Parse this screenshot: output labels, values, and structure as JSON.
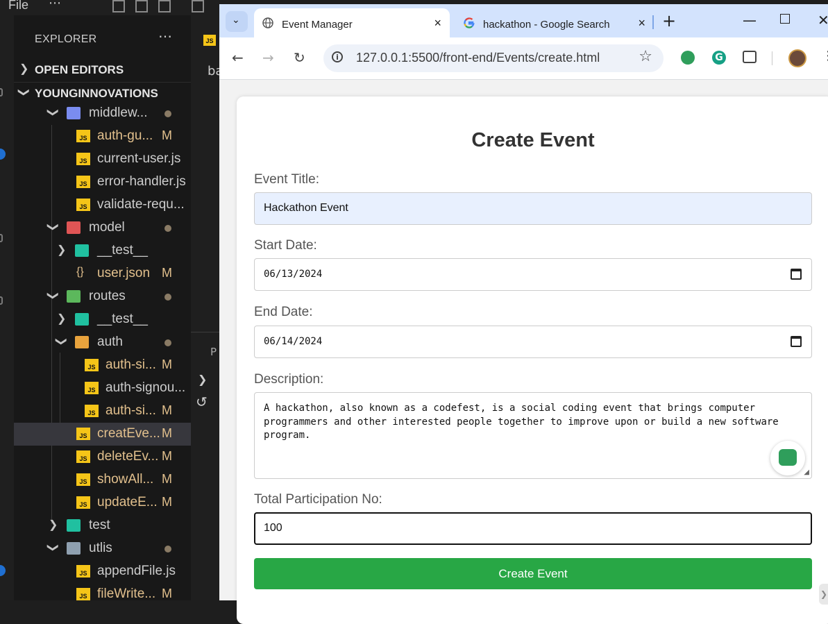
{
  "vscode": {
    "menu_file": "File",
    "menu_more": "⋯",
    "explorer_title": "EXPLORER",
    "explorer_more": "⋯",
    "open_editors": "OPEN EDITORS",
    "workspace": "YOUNGINNOVATIONS",
    "editor_tab_icon": "JS",
    "editor_text": "ba",
    "panel_text": "P",
    "tree": [
      {
        "name": "middlew...",
        "kind": "folder",
        "icon": "middleware-folder-icon",
        "chevron": "open",
        "status": "dot"
      },
      {
        "name": "auth-gu...",
        "kind": "js",
        "status": "M"
      },
      {
        "name": "current-user.js",
        "kind": "js",
        "status": ""
      },
      {
        "name": "error-handler.js",
        "kind": "js",
        "status": ""
      },
      {
        "name": "validate-requ...",
        "kind": "js",
        "status": ""
      },
      {
        "name": "model",
        "kind": "folder",
        "icon": "model-folder-icon",
        "chevron": "open",
        "status": "dot"
      },
      {
        "name": "__test__",
        "kind": "folder",
        "icon": "test-folder-icon",
        "chevron": "closed",
        "status": ""
      },
      {
        "name": "user.json",
        "kind": "json",
        "status": "M"
      },
      {
        "name": "routes",
        "kind": "folder",
        "icon": "routes-folder-icon",
        "chevron": "open",
        "status": "dot"
      },
      {
        "name": "__test__",
        "kind": "folder",
        "icon": "test-folder-icon",
        "chevron": "closed",
        "status": ""
      },
      {
        "name": "auth",
        "kind": "folder",
        "icon": "auth-folder-icon",
        "chevron": "open",
        "status": "dot"
      },
      {
        "name": "auth-si...",
        "kind": "js",
        "status": "M"
      },
      {
        "name": "auth-signou...",
        "kind": "js",
        "status": ""
      },
      {
        "name": "auth-si...",
        "kind": "js",
        "status": "M"
      },
      {
        "name": "creatEve...",
        "kind": "js",
        "status": "M"
      },
      {
        "name": "deleteEv...",
        "kind": "js",
        "status": "M"
      },
      {
        "name": "showAll...",
        "kind": "js",
        "status": "M"
      },
      {
        "name": "updateE...",
        "kind": "js",
        "status": "M"
      },
      {
        "name": "test",
        "kind": "folder",
        "icon": "test-folder-icon",
        "chevron": "closed",
        "status": ""
      },
      {
        "name": "utlis",
        "kind": "folder",
        "icon": "folder-icon",
        "chevron": "open",
        "status": "dot"
      },
      {
        "name": "appendFile.js",
        "kind": "js",
        "status": ""
      },
      {
        "name": "fileWrite...",
        "kind": "js",
        "status": "M"
      }
    ],
    "modified_color": "#e2c08d",
    "js_icon_color": "#f5c518"
  },
  "browser": {
    "tabs": [
      {
        "title": "Event Manager",
        "favicon": "globe-icon"
      },
      {
        "title": "hackathon - Google Search",
        "favicon": "google-icon"
      }
    ],
    "tab_close": "×",
    "new_tab": "+",
    "url": "127.0.0.1:5500/front-end/Events/create.html",
    "toolbar_bg": "#d3e3fd"
  },
  "form": {
    "heading": "Create Event",
    "title_label": "Event Title:",
    "title_value": "Hackathon Event",
    "start_label": "Start Date:",
    "start_value": "06/13/2024",
    "end_label": "End Date:",
    "end_value": "06/14/2024",
    "description_label": "Description:",
    "description_value": "A hackathon, also known as a codefest, is a social coding event that brings computer programmers and other interested people together to improve upon or build a new software program.",
    "participation_label": "Total Participation No:",
    "participation_value": "100",
    "submit_label": "Create Event",
    "submit_color": "#28a745"
  }
}
